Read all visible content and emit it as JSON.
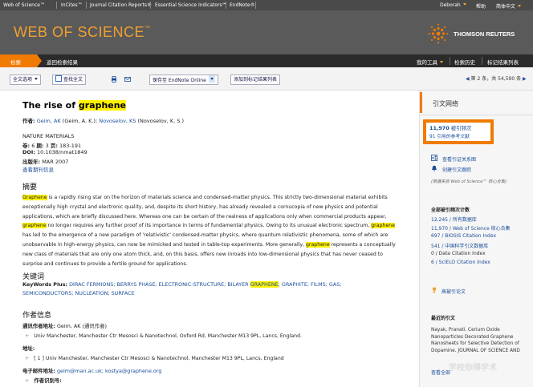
{
  "topnav": {
    "items": [
      "Web of Science™",
      "InCites™",
      "Journal Citation Reports®",
      "Essential Science Indicators℠",
      "EndNote®"
    ],
    "user": "Deborah",
    "help": "帮助",
    "lang": "简体中文"
  },
  "header": {
    "logo": "WEB OF SCIENCE",
    "logo_tm": "™",
    "brand": "THOMSON REUTERS"
  },
  "subnav": {
    "search": "检索",
    "back": "返回检索结果",
    "tools": "我的工具",
    "history": "检索历史",
    "marked": "标记结果列表"
  },
  "toolbar": {
    "fulltext": "全文选项",
    "find_fulltext": "查找全文",
    "save_to": "保存至 EndNote Online",
    "add_marked": "添加到标记结果列表",
    "pager_prefix": "第",
    "pager_num": "2",
    "pager_mid": "条，共",
    "pager_total": "54,590",
    "pager_suffix": "条"
  },
  "record": {
    "title_pre": "The rise of ",
    "title_hl": "graphene",
    "authors_label": "作者:",
    "author1": "Geim, AK",
    "author1_full": "(Geim, A. K.);",
    "author2": "Novoselov, KS",
    "author2_full": "(Novoselov, K. S.)",
    "journal": "NATURE MATERIALS",
    "vol_label": "卷:",
    "vol": "6",
    "issue_label": "期:",
    "issue": "3",
    "pages_label": "页:",
    "pages": "183-191",
    "doi_label": "DOI:",
    "doi": "10.1038/nmat1849",
    "date_label": "出版年:",
    "date": "MAR 2007",
    "journal_info": "查看期刊信息",
    "abstract_head": "摘要",
    "abstract_parts": [
      {
        "hl": true,
        "text": "Graphene"
      },
      {
        "hl": false,
        "text": " is a rapidly rising star on the horizon of materials science and condensed-matter physics. This strictly two-dimensional material exhibits exceptionally high crystal and electronic quality, and, despite its short history, has already revealed a cornucopia of new physics and potential applications, which are briefly discussed here. Whereas one can be certain of the realness of applications only when commercial products appear, "
      },
      {
        "hl": true,
        "text": "graphene"
      },
      {
        "hl": false,
        "text": " no longer requires any further proof of its importance in terms of fundamental physics. Owing to its unusual electronic spectrum, "
      },
      {
        "hl": true,
        "text": "graphene"
      },
      {
        "hl": false,
        "text": " has led to the emergence of a new paradigm of 'relativistic' condensed-matter physics, where quantum relativistic phenomena, some of which are unobservable in high-energy physics, can now be mimicked and tested in table-top experiments. More generally, "
      },
      {
        "hl": true,
        "text": "graphene"
      },
      {
        "hl": false,
        "text": " represents a conceptually new class of materials that are only one atom thick, and, on this basis, offers new inroads into low-dimensional physics that has never ceased to surprise and continues to provide a fertile ground for applications."
      }
    ],
    "keywords_head": "关键词",
    "kw_label": "KeyWords Plus:",
    "kw_pre": "DIRAC FERMIONS; BERRYS PHASE; ELECTRONIC-STRUCTURE; BILAYER",
    "kw_hl": "GRAPHENE",
    "kw_post": "; GRAPHITE; FILMS; GAS; SEMICONDUCTORS; NUCLEATION; SURFACE",
    "author_info_head": "作者信息",
    "corr_label": "通讯作者地址:",
    "corr_name": "Geim, AK (通讯作者)",
    "corr_addr": "Univ Manchester, Manchester Ctr Mesosci & Nanotechnol, Oxford Rd, Manchester M13 9PL, Lancs, England.",
    "addr_label": "地址:",
    "addr1": "[ 1 ] Univ Manchester, Manchester Ctr Mesosci & Nanotechnol, Manchester M13 9PL, Lancs, England",
    "email_label": "电子邮件地址:",
    "email": "geim@man.ac.uk; kostya@graphene.org",
    "ids_label": "作者识别号:"
  },
  "sidebar": {
    "title": "引文网络",
    "cited_count": "11,970",
    "cited_label": "被引频次",
    "refs_partial": "91 引用的参考文献",
    "related": "Related Records",
    "view_map": "查看引证关系图",
    "create_alert": "创建引文跟踪",
    "data_note": "(数据来自 Web of Science™ 核心合集)",
    "all_db_head": "全部被引频次计数",
    "counts": [
      "12,245 / 所有数据库",
      "11,970 / Web of Science 核心合集",
      "697 / BIOSIS Citation Index",
      "541 / 中国科学引文数据库",
      "0 / Data Citation Index",
      "6 / SciELO Citation Index"
    ],
    "highly_cited": "高被引论文",
    "recent_head": "最近的引文",
    "recent_text": "Nayak, Pranati. Cerium Oxide Nanoparticles Decorated Graphene Nanosheets for Selective Detection of Dopamine. JOURNAL OF",
    "recent_more": "SCIENCE AND",
    "view_all": "查看全部",
    "watermark": "学校你得学术"
  },
  "colors": {
    "accent": "#f07b00",
    "highlight": "#fff200",
    "link": "#1a4d9a"
  }
}
